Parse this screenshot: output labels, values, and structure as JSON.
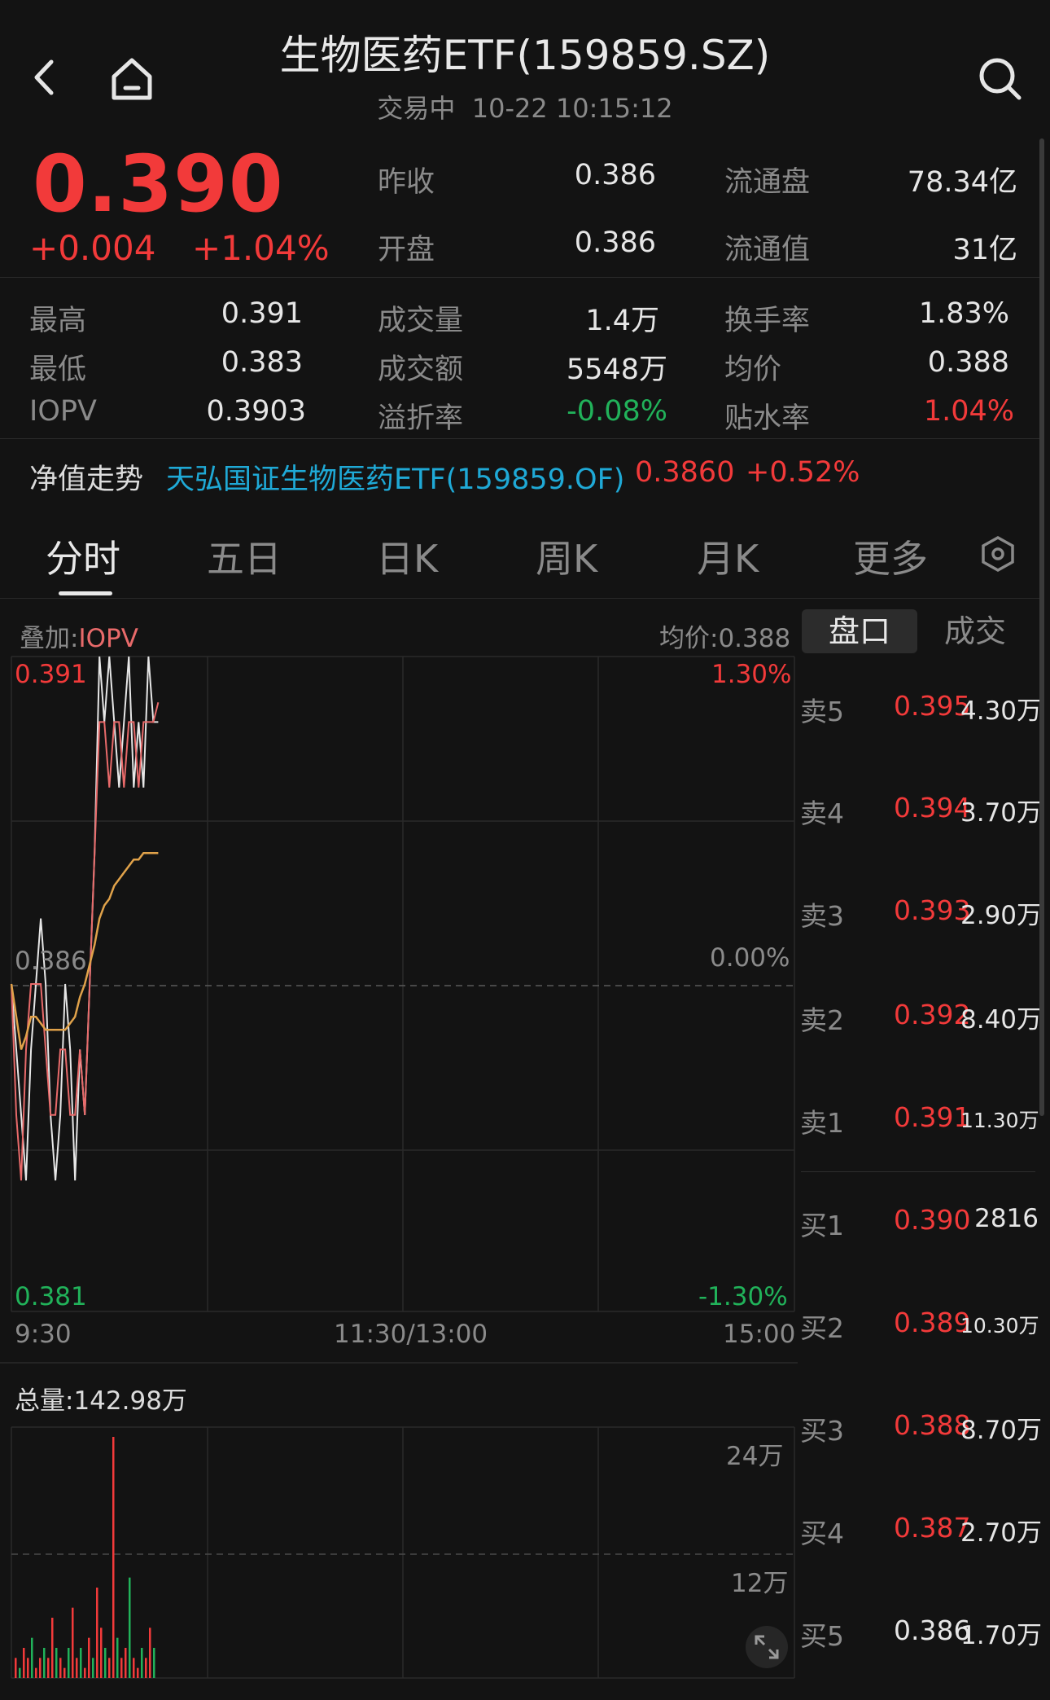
{
  "header": {
    "title": "生物医药ETF(159859.SZ)",
    "status": "交易中",
    "datetime": "10-22 10:15:12"
  },
  "quote": {
    "price": "0.390",
    "change": "+0.004",
    "change_pct": "+1.04%",
    "stats": [
      {
        "label": "昨收",
        "value": "0.386"
      },
      {
        "label": "开盘",
        "value": "0.386"
      },
      {
        "label": "流通盘",
        "value": "78.34亿"
      },
      {
        "label": "流通值",
        "value": "31亿"
      },
      {
        "label": "最高",
        "value": "0.391"
      },
      {
        "label": "最低",
        "value": "0.383"
      },
      {
        "label": "IOPV",
        "value": "0.3903"
      },
      {
        "label": "成交量",
        "value": "1.4万"
      },
      {
        "label": "成交额",
        "value": "5548万"
      },
      {
        "label": "溢折率",
        "value": "-0.08%"
      },
      {
        "label": "换手率",
        "value": "1.83%"
      },
      {
        "label": "均价",
        "value": "0.388"
      },
      {
        "label": "贴水率",
        "value": "1.04%"
      }
    ]
  },
  "nav": {
    "label": "净值走势",
    "fund": "天弘国证生物医药ETF(159859.OF)",
    "value": "0.3860",
    "change": "+0.52%"
  },
  "tabs": [
    "分时",
    "五日",
    "日K",
    "周K",
    "月K",
    "更多"
  ],
  "chart": {
    "overlay_prefix": "叠加:",
    "overlay_name": "IOPV",
    "avg_label": "均价:0.388",
    "y_high": "0.391",
    "y_mid": "0.386",
    "y_low": "0.381",
    "pct_high": "1.30%",
    "pct_mid": "0.00%",
    "pct_low": "-1.30%",
    "time_start": "9:30",
    "time_mid": "11:30/13:00",
    "time_end": "15:00",
    "volume_total": "总量:142.98万",
    "vol_high": "24万",
    "vol_mid": "12万"
  },
  "chart_data": {
    "type": "line",
    "ylim": [
      0.381,
      0.391
    ],
    "series": [
      {
        "name": "",
        "color": "#e6e6e6",
        "values": [
          0.386,
          0.385,
          0.384,
          0.383,
          0.385,
          0.386,
          0.387,
          0.386,
          0.384,
          0.383,
          0.384,
          0.386,
          0.385,
          0.383,
          0.385,
          0.384,
          0.386,
          0.388,
          0.391,
          0.39,
          0.391,
          0.39,
          0.389,
          0.39,
          0.391,
          0.389,
          0.39,
          0.389,
          0.391,
          0.39,
          0.39
        ]
      },
      {
        "name": "IOPV",
        "color": "#e86a6a",
        "values": [
          0.386,
          0.384,
          0.383,
          0.385,
          0.386,
          0.386,
          0.386,
          0.385,
          0.384,
          0.384,
          0.385,
          0.385,
          0.384,
          0.384,
          0.385,
          0.384,
          0.386,
          0.388,
          0.39,
          0.39,
          0.389,
          0.39,
          0.39,
          0.389,
          0.39,
          0.39,
          0.389,
          0.39,
          0.39,
          0.39,
          0.3903
        ]
      },
      {
        "name": "均价",
        "color": "#e0a24a",
        "values": [
          0.386,
          0.3855,
          0.385,
          0.3852,
          0.3855,
          0.3855,
          0.3854,
          0.3853,
          0.3853,
          0.3853,
          0.3853,
          0.3853,
          0.3854,
          0.3855,
          0.3858,
          0.386,
          0.3863,
          0.3866,
          0.387,
          0.3872,
          0.3873,
          0.3875,
          0.3876,
          0.3877,
          0.3878,
          0.3879,
          0.3879,
          0.388,
          0.388,
          0.388,
          0.388
        ]
      }
    ],
    "volume": [
      2,
      1,
      3,
      2,
      4,
      1,
      2,
      3,
      2,
      6,
      3,
      2,
      1,
      3,
      7,
      2,
      3,
      1,
      4,
      2,
      9,
      5,
      3,
      2,
      24,
      4,
      2,
      3,
      10,
      2,
      1,
      3,
      2,
      5,
      3
    ]
  },
  "orderbook": {
    "tab_active": "盘口",
    "tab_other": "成交",
    "asks": [
      {
        "label": "卖5",
        "price": "0.395",
        "vol": "4.30万"
      },
      {
        "label": "卖4",
        "price": "0.394",
        "vol": "3.70万"
      },
      {
        "label": "卖3",
        "price": "0.393",
        "vol": "2.90万"
      },
      {
        "label": "卖2",
        "price": "0.392",
        "vol": "8.40万"
      },
      {
        "label": "卖1",
        "price": "0.391",
        "vol": "11.30万"
      }
    ],
    "bids": [
      {
        "label": "买1",
        "price": "0.390",
        "vol": "2816"
      },
      {
        "label": "买2",
        "price": "0.389",
        "vol": "10.30万"
      },
      {
        "label": "买3",
        "price": "0.388",
        "vol": "8.70万"
      },
      {
        "label": "买4",
        "price": "0.387",
        "vol": "2.70万"
      },
      {
        "label": "买5",
        "price": "0.386",
        "vol": "1.70万"
      }
    ]
  },
  "colors": {
    "up": "#f23a3a",
    "down": "#21b25a",
    "flat": "#e6e6e6"
  }
}
